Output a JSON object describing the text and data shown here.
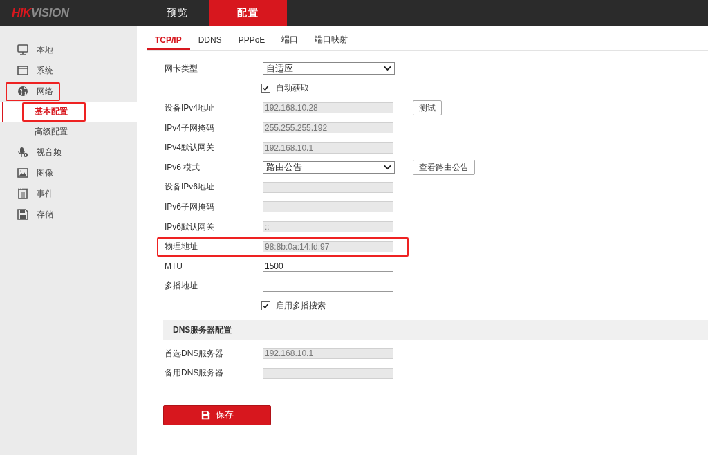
{
  "header": {
    "logo": "HIKVISION",
    "nav": [
      {
        "label": "预览",
        "selected": false
      },
      {
        "label": "配置",
        "selected": true
      }
    ]
  },
  "sidebar": {
    "items": [
      {
        "label": "本地",
        "selected": false,
        "highlighted": false
      },
      {
        "label": "系统",
        "selected": false,
        "highlighted": false
      },
      {
        "label": "网络",
        "selected": false,
        "highlighted": true,
        "children": [
          {
            "label": "基本配置",
            "selected": true,
            "highlighted": true
          },
          {
            "label": "高级配置",
            "selected": false,
            "highlighted": false
          }
        ]
      },
      {
        "label": "视音频",
        "selected": false,
        "highlighted": false
      },
      {
        "label": "图像",
        "selected": false,
        "highlighted": false
      },
      {
        "label": "事件",
        "selected": false,
        "highlighted": false
      },
      {
        "label": "存储",
        "selected": false,
        "highlighted": false
      }
    ]
  },
  "tabs": [
    {
      "label": "TCP/IP",
      "selected": true
    },
    {
      "label": "DDNS",
      "selected": false
    },
    {
      "label": "PPPoE",
      "selected": false
    },
    {
      "label": "端口",
      "selected": false
    },
    {
      "label": "端口映射",
      "selected": false
    }
  ],
  "form": [
    {
      "kind": "select",
      "label": "网卡类型",
      "value": "自适应"
    },
    {
      "kind": "checkbox",
      "label": "自动获取",
      "checked": true
    },
    {
      "kind": "input",
      "label": "设备IPv4地址",
      "value": "192.168.10.28",
      "disabled": true,
      "button": "测试"
    },
    {
      "kind": "input",
      "label": "IPv4子网掩码",
      "value": "255.255.255.192",
      "disabled": true
    },
    {
      "kind": "input",
      "label": "IPv4默认网关",
      "value": "192.168.10.1",
      "disabled": true
    },
    {
      "kind": "select",
      "label": "IPv6 模式",
      "value": "路由公告",
      "button": "查看路由公告"
    },
    {
      "kind": "input",
      "label": "设备IPv6地址",
      "disabled": true
    },
    {
      "kind": "input",
      "label": "IPv6子网掩码",
      "disabled": true
    },
    {
      "kind": "input",
      "label": "IPv6默认网关",
      "value": "::",
      "disabled": true
    },
    {
      "kind": "input",
      "label": "物理地址",
      "value": "98:8b:0a:14:fd:97",
      "disabled": true,
      "highlighted": true
    },
    {
      "kind": "input",
      "label": "MTU",
      "value": "1500",
      "disabled": false
    },
    {
      "kind": "input",
      "label": "多播地址",
      "disabled": false
    },
    {
      "kind": "checkbox",
      "label": "启用多播搜索",
      "checked": true
    },
    {
      "kind": "section",
      "label": "DNS服务器配置"
    },
    {
      "kind": "input",
      "label": "首选DNS服务器",
      "value": "192.168.10.1",
      "disabled": true
    },
    {
      "kind": "input",
      "label": "备用DNS服务器",
      "disabled": true
    }
  ],
  "save_button": "保存"
}
